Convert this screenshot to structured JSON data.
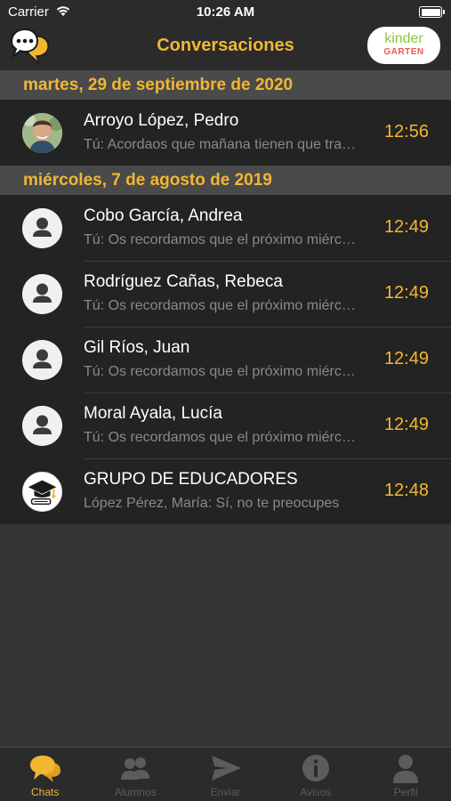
{
  "status_bar": {
    "carrier": "Carrier",
    "time": "10:26 AM"
  },
  "nav": {
    "title": "Conversaciones",
    "brand_top": "kinder",
    "brand_bottom": "GARTEN"
  },
  "sections": [
    {
      "date": "martes, 29 de septiembre de 2020",
      "conversations": [
        {
          "name": "Arroyo López, Pedro",
          "preview": "Tú: Acordaos que mañana tienen que traer el disfraz",
          "time": "12:56",
          "avatar": "photo"
        }
      ]
    },
    {
      "date": "miércoles, 7 de agosto de 2019",
      "conversations": [
        {
          "name": "Cobo García, Andrea",
          "preview": "Tú: Os recordamos que el próximo miércoles",
          "time": "12:49",
          "avatar": "default"
        },
        {
          "name": "Rodríguez Cañas, Rebeca",
          "preview": "Tú: Os recordamos que el próximo miércoles",
          "time": "12:49",
          "avatar": "default"
        },
        {
          "name": "Gil Ríos, Juan",
          "preview": "Tú: Os recordamos que el próximo miércoles",
          "time": "12:49",
          "avatar": "default"
        },
        {
          "name": "Moral Ayala, Lucía",
          "preview": "Tú: Os recordamos que el próximo miércoles",
          "time": "12:49",
          "avatar": "default"
        },
        {
          "name": "GRUPO DE EDUCADORES",
          "preview": "López Pérez, María: Sí, no te preocupes",
          "time": "12:48",
          "avatar": "group"
        }
      ]
    }
  ],
  "tabs": [
    {
      "label": "Chats",
      "icon": "chat-bubbles-icon",
      "active": true
    },
    {
      "label": "Alumnos",
      "icon": "students-icon",
      "active": false
    },
    {
      "label": "Enviar",
      "icon": "send-icon",
      "active": false
    },
    {
      "label": "Avisos",
      "icon": "info-icon",
      "active": false
    },
    {
      "label": "Perfil",
      "icon": "profile-icon",
      "active": false
    }
  ],
  "colors": {
    "accent": "#f2b632",
    "background": "#353535",
    "row": "#232323",
    "header": "#4a4a4a",
    "inactive": "#5c5c5c"
  }
}
